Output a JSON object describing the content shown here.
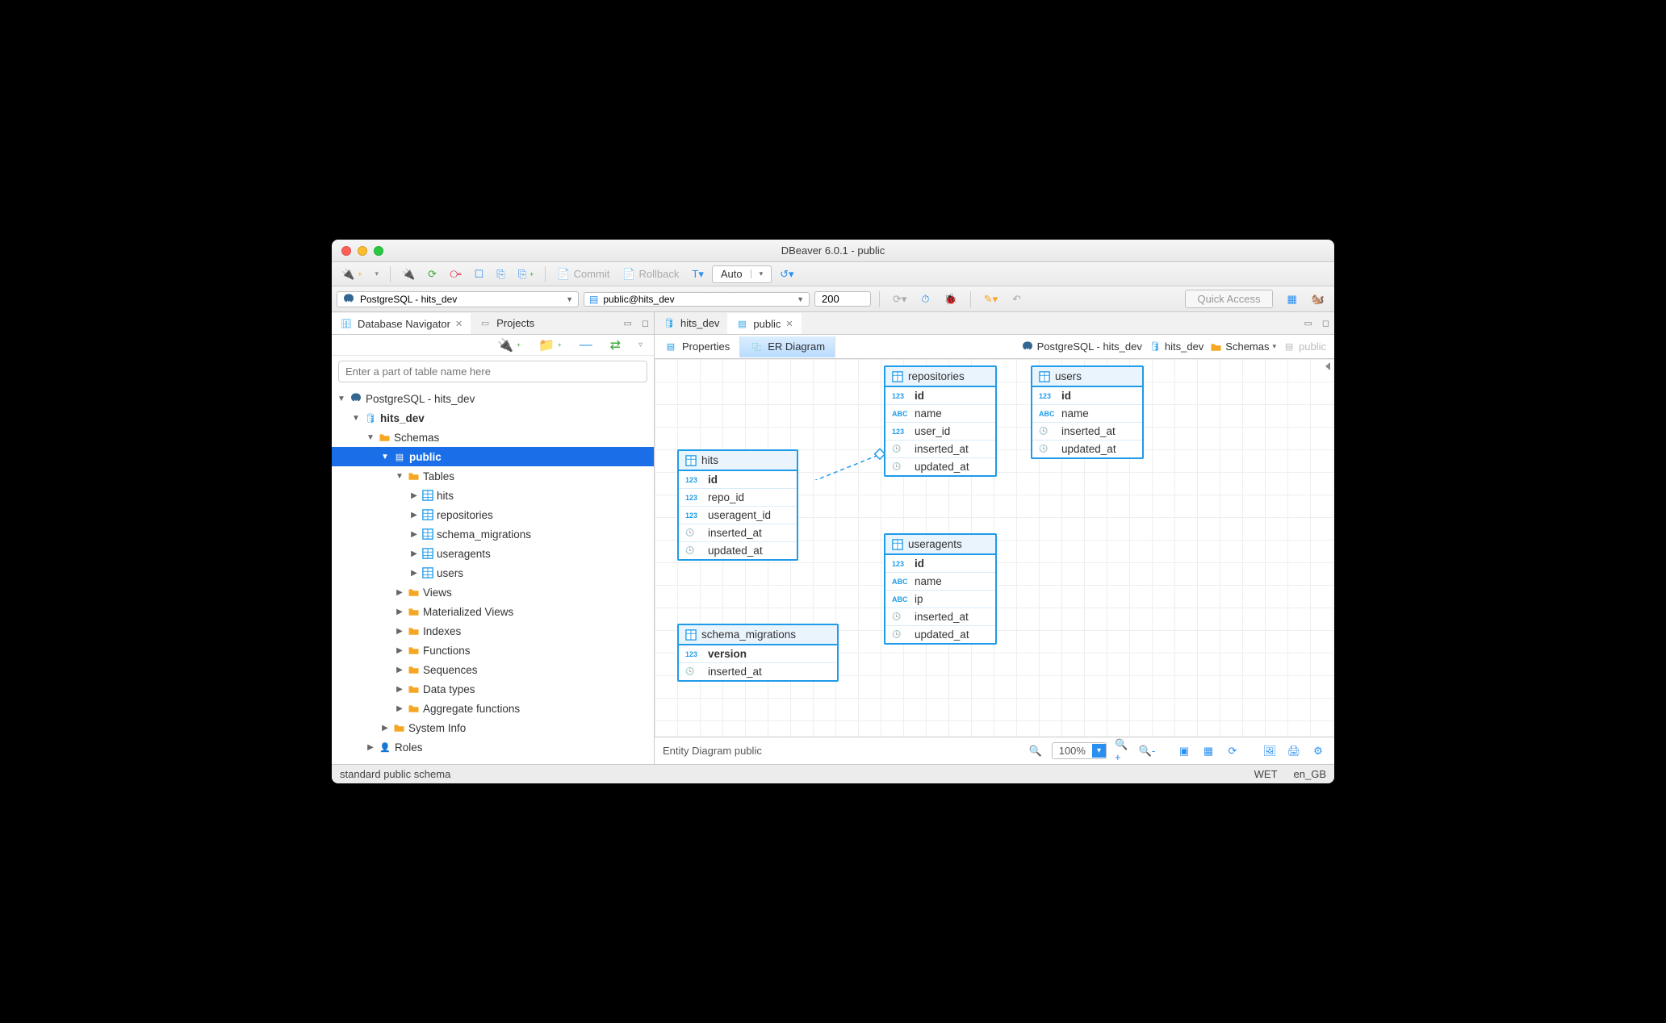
{
  "window": {
    "title": "DBeaver 6.0.1 - public"
  },
  "toolbar": {
    "commit": "Commit",
    "rollback": "Rollback",
    "auto": "Auto"
  },
  "toolbar2": {
    "connection": "PostgreSQL - hits_dev",
    "schema": "public@hits_dev",
    "limit": "200",
    "quick_access": "Quick Access"
  },
  "left": {
    "tabs": {
      "nav": "Database Navigator",
      "projects": "Projects"
    },
    "search_placeholder": "Enter a part of table name here",
    "tree": {
      "conn": "PostgreSQL - hits_dev",
      "db": "hits_dev",
      "schemas": "Schemas",
      "public": "public",
      "tables": "Tables",
      "t1": "hits",
      "t2": "repositories",
      "t3": "schema_migrations",
      "t4": "useragents",
      "t5": "users",
      "views": "Views",
      "mviews": "Materialized Views",
      "indexes": "Indexes",
      "functions": "Functions",
      "sequences": "Sequences",
      "datatypes": "Data types",
      "aggfn": "Aggregate functions",
      "sysinfo": "System Info",
      "roles": "Roles"
    }
  },
  "right": {
    "tabs": {
      "hits_dev": "hits_dev",
      "public": "public"
    },
    "subtabs": {
      "properties": "Properties",
      "er": "ER Diagram"
    },
    "breadcrumb": {
      "conn": "PostgreSQL - hits_dev",
      "db": "hits_dev",
      "schemas": "Schemas",
      "public": "public"
    },
    "footer": {
      "label": "Entity Diagram  public",
      "zoom": "100%"
    }
  },
  "entities": {
    "hits": {
      "name": "hits",
      "cols": [
        {
          "t": "123",
          "n": "id",
          "b": true
        },
        {
          "t": "123",
          "n": "repo_id"
        },
        {
          "t": "123",
          "n": "useragent_id"
        },
        {
          "t": "clk",
          "n": "inserted_at"
        },
        {
          "t": "clk",
          "n": "updated_at"
        }
      ]
    },
    "repositories": {
      "name": "repositories",
      "cols": [
        {
          "t": "123",
          "n": "id",
          "b": true
        },
        {
          "t": "ABC",
          "n": "name"
        },
        {
          "t": "123",
          "n": "user_id"
        },
        {
          "t": "clk",
          "n": "inserted_at"
        },
        {
          "t": "clk",
          "n": "updated_at"
        }
      ]
    },
    "users": {
      "name": "users",
      "cols": [
        {
          "t": "123",
          "n": "id",
          "b": true
        },
        {
          "t": "ABC",
          "n": "name"
        },
        {
          "t": "clk",
          "n": "inserted_at"
        },
        {
          "t": "clk",
          "n": "updated_at"
        }
      ]
    },
    "useragents": {
      "name": "useragents",
      "cols": [
        {
          "t": "123",
          "n": "id",
          "b": true
        },
        {
          "t": "ABC",
          "n": "name"
        },
        {
          "t": "ABC",
          "n": "ip"
        },
        {
          "t": "clk",
          "n": "inserted_at"
        },
        {
          "t": "clk",
          "n": "updated_at"
        }
      ]
    },
    "schema_migrations": {
      "name": "schema_migrations",
      "cols": [
        {
          "t": "123",
          "n": "version",
          "b": true
        },
        {
          "t": "clk",
          "n": "inserted_at"
        }
      ]
    }
  },
  "status": {
    "desc": "standard public schema",
    "tz": "WET",
    "locale": "en_GB"
  }
}
